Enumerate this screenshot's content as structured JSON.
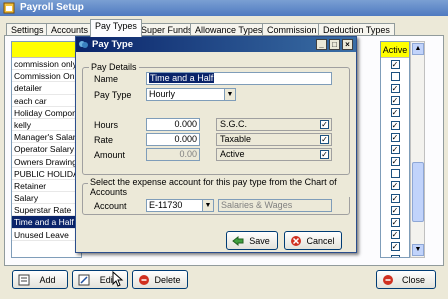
{
  "window": {
    "title": "Payroll Setup"
  },
  "tabs": [
    "Settings",
    "Accounts",
    "Pay Types",
    "Super Funds",
    "Allowance Types",
    "Commission",
    "Deduction Types"
  ],
  "list": {
    "items": [
      "commission only",
      "Commission Only",
      "detailer",
      "each car",
      "Holiday Compone",
      "kelly",
      "Manager's Salary",
      "Operator Salary",
      "Owners Drawings",
      "PUBLIC HOLIDA",
      "Retainer",
      "Salary",
      "Superstar Rate",
      "Time and a Half",
      "Unused Leave"
    ],
    "selected_index": 13
  },
  "active_column": {
    "header": "Active",
    "checks": [
      true,
      false,
      true,
      true,
      true,
      true,
      true,
      true,
      true,
      false,
      true,
      true,
      true,
      true,
      true,
      true,
      true
    ]
  },
  "bottom_buttons": {
    "add": "Add",
    "edit": "Edit",
    "delete": "Delete",
    "close": "Close"
  },
  "dialog": {
    "title": "Pay Type",
    "details_group": "Pay Details",
    "name_label": "Name",
    "name_value": "Time and a Half",
    "paytype_label": "Pay Type",
    "paytype_value": "Hourly",
    "hours_label": "Hours",
    "hours_value": "0.000",
    "rate_label": "Rate",
    "rate_value": "0.000",
    "amount_label": "Amount",
    "amount_value": "0.00",
    "sgc_label": "S.G.C.",
    "sgc_checked": true,
    "taxable_label": "Taxable",
    "taxable_checked": true,
    "active_label": "Active",
    "active_checked": true,
    "expense_text": "Select the expense account for this pay type from the Chart of Accounts",
    "account_label": "Account",
    "account_value": "E-11730",
    "account_name": "Salaries & Wages",
    "save": "Save",
    "cancel": "Cancel"
  },
  "colors": {
    "highlight": "#0a246a",
    "header_yellow": "#ffff00",
    "title_blue": "#0a246a"
  }
}
